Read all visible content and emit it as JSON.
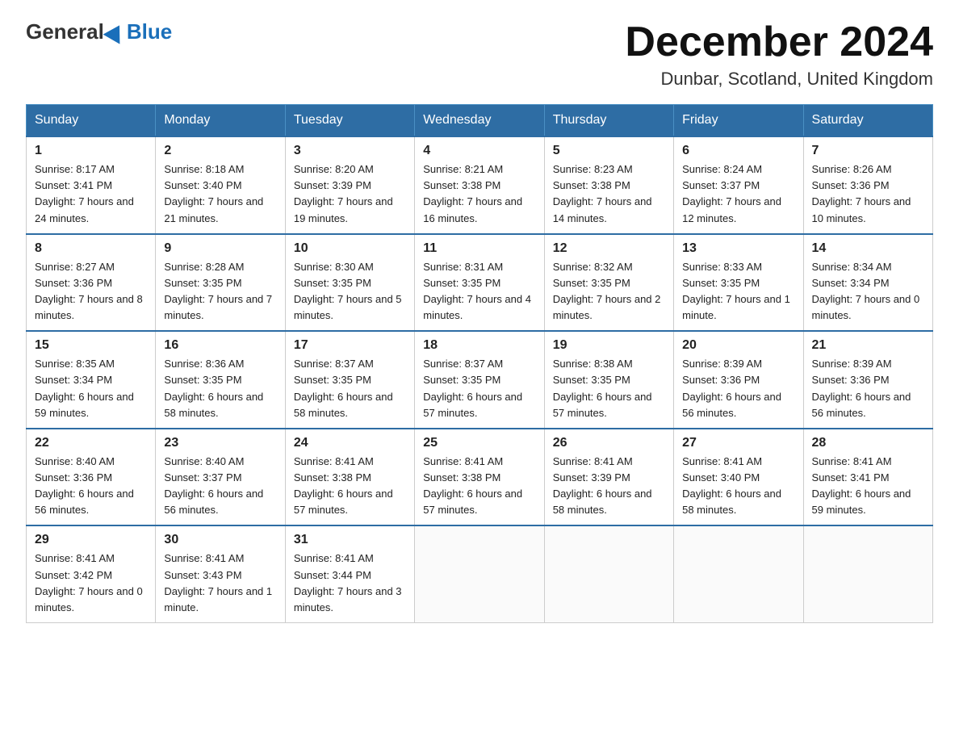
{
  "header": {
    "logo_general": "General",
    "logo_blue": "Blue",
    "month_title": "December 2024",
    "location": "Dunbar, Scotland, United Kingdom"
  },
  "days_of_week": [
    "Sunday",
    "Monday",
    "Tuesday",
    "Wednesday",
    "Thursday",
    "Friday",
    "Saturday"
  ],
  "weeks": [
    [
      {
        "day": "1",
        "sunrise": "8:17 AM",
        "sunset": "3:41 PM",
        "daylight": "7 hours and 24 minutes."
      },
      {
        "day": "2",
        "sunrise": "8:18 AM",
        "sunset": "3:40 PM",
        "daylight": "7 hours and 21 minutes."
      },
      {
        "day": "3",
        "sunrise": "8:20 AM",
        "sunset": "3:39 PM",
        "daylight": "7 hours and 19 minutes."
      },
      {
        "day": "4",
        "sunrise": "8:21 AM",
        "sunset": "3:38 PM",
        "daylight": "7 hours and 16 minutes."
      },
      {
        "day": "5",
        "sunrise": "8:23 AM",
        "sunset": "3:38 PM",
        "daylight": "7 hours and 14 minutes."
      },
      {
        "day": "6",
        "sunrise": "8:24 AM",
        "sunset": "3:37 PM",
        "daylight": "7 hours and 12 minutes."
      },
      {
        "day": "7",
        "sunrise": "8:26 AM",
        "sunset": "3:36 PM",
        "daylight": "7 hours and 10 minutes."
      }
    ],
    [
      {
        "day": "8",
        "sunrise": "8:27 AM",
        "sunset": "3:36 PM",
        "daylight": "7 hours and 8 minutes."
      },
      {
        "day": "9",
        "sunrise": "8:28 AM",
        "sunset": "3:35 PM",
        "daylight": "7 hours and 7 minutes."
      },
      {
        "day": "10",
        "sunrise": "8:30 AM",
        "sunset": "3:35 PM",
        "daylight": "7 hours and 5 minutes."
      },
      {
        "day": "11",
        "sunrise": "8:31 AM",
        "sunset": "3:35 PM",
        "daylight": "7 hours and 4 minutes."
      },
      {
        "day": "12",
        "sunrise": "8:32 AM",
        "sunset": "3:35 PM",
        "daylight": "7 hours and 2 minutes."
      },
      {
        "day": "13",
        "sunrise": "8:33 AM",
        "sunset": "3:35 PM",
        "daylight": "7 hours and 1 minute."
      },
      {
        "day": "14",
        "sunrise": "8:34 AM",
        "sunset": "3:34 PM",
        "daylight": "7 hours and 0 minutes."
      }
    ],
    [
      {
        "day": "15",
        "sunrise": "8:35 AM",
        "sunset": "3:34 PM",
        "daylight": "6 hours and 59 minutes."
      },
      {
        "day": "16",
        "sunrise": "8:36 AM",
        "sunset": "3:35 PM",
        "daylight": "6 hours and 58 minutes."
      },
      {
        "day": "17",
        "sunrise": "8:37 AM",
        "sunset": "3:35 PM",
        "daylight": "6 hours and 58 minutes."
      },
      {
        "day": "18",
        "sunrise": "8:37 AM",
        "sunset": "3:35 PM",
        "daylight": "6 hours and 57 minutes."
      },
      {
        "day": "19",
        "sunrise": "8:38 AM",
        "sunset": "3:35 PM",
        "daylight": "6 hours and 57 minutes."
      },
      {
        "day": "20",
        "sunrise": "8:39 AM",
        "sunset": "3:36 PM",
        "daylight": "6 hours and 56 minutes."
      },
      {
        "day": "21",
        "sunrise": "8:39 AM",
        "sunset": "3:36 PM",
        "daylight": "6 hours and 56 minutes."
      }
    ],
    [
      {
        "day": "22",
        "sunrise": "8:40 AM",
        "sunset": "3:36 PM",
        "daylight": "6 hours and 56 minutes."
      },
      {
        "day": "23",
        "sunrise": "8:40 AM",
        "sunset": "3:37 PM",
        "daylight": "6 hours and 56 minutes."
      },
      {
        "day": "24",
        "sunrise": "8:41 AM",
        "sunset": "3:38 PM",
        "daylight": "6 hours and 57 minutes."
      },
      {
        "day": "25",
        "sunrise": "8:41 AM",
        "sunset": "3:38 PM",
        "daylight": "6 hours and 57 minutes."
      },
      {
        "day": "26",
        "sunrise": "8:41 AM",
        "sunset": "3:39 PM",
        "daylight": "6 hours and 58 minutes."
      },
      {
        "day": "27",
        "sunrise": "8:41 AM",
        "sunset": "3:40 PM",
        "daylight": "6 hours and 58 minutes."
      },
      {
        "day": "28",
        "sunrise": "8:41 AM",
        "sunset": "3:41 PM",
        "daylight": "6 hours and 59 minutes."
      }
    ],
    [
      {
        "day": "29",
        "sunrise": "8:41 AM",
        "sunset": "3:42 PM",
        "daylight": "7 hours and 0 minutes."
      },
      {
        "day": "30",
        "sunrise": "8:41 AM",
        "sunset": "3:43 PM",
        "daylight": "7 hours and 1 minute."
      },
      {
        "day": "31",
        "sunrise": "8:41 AM",
        "sunset": "3:44 PM",
        "daylight": "7 hours and 3 minutes."
      },
      null,
      null,
      null,
      null
    ]
  ]
}
